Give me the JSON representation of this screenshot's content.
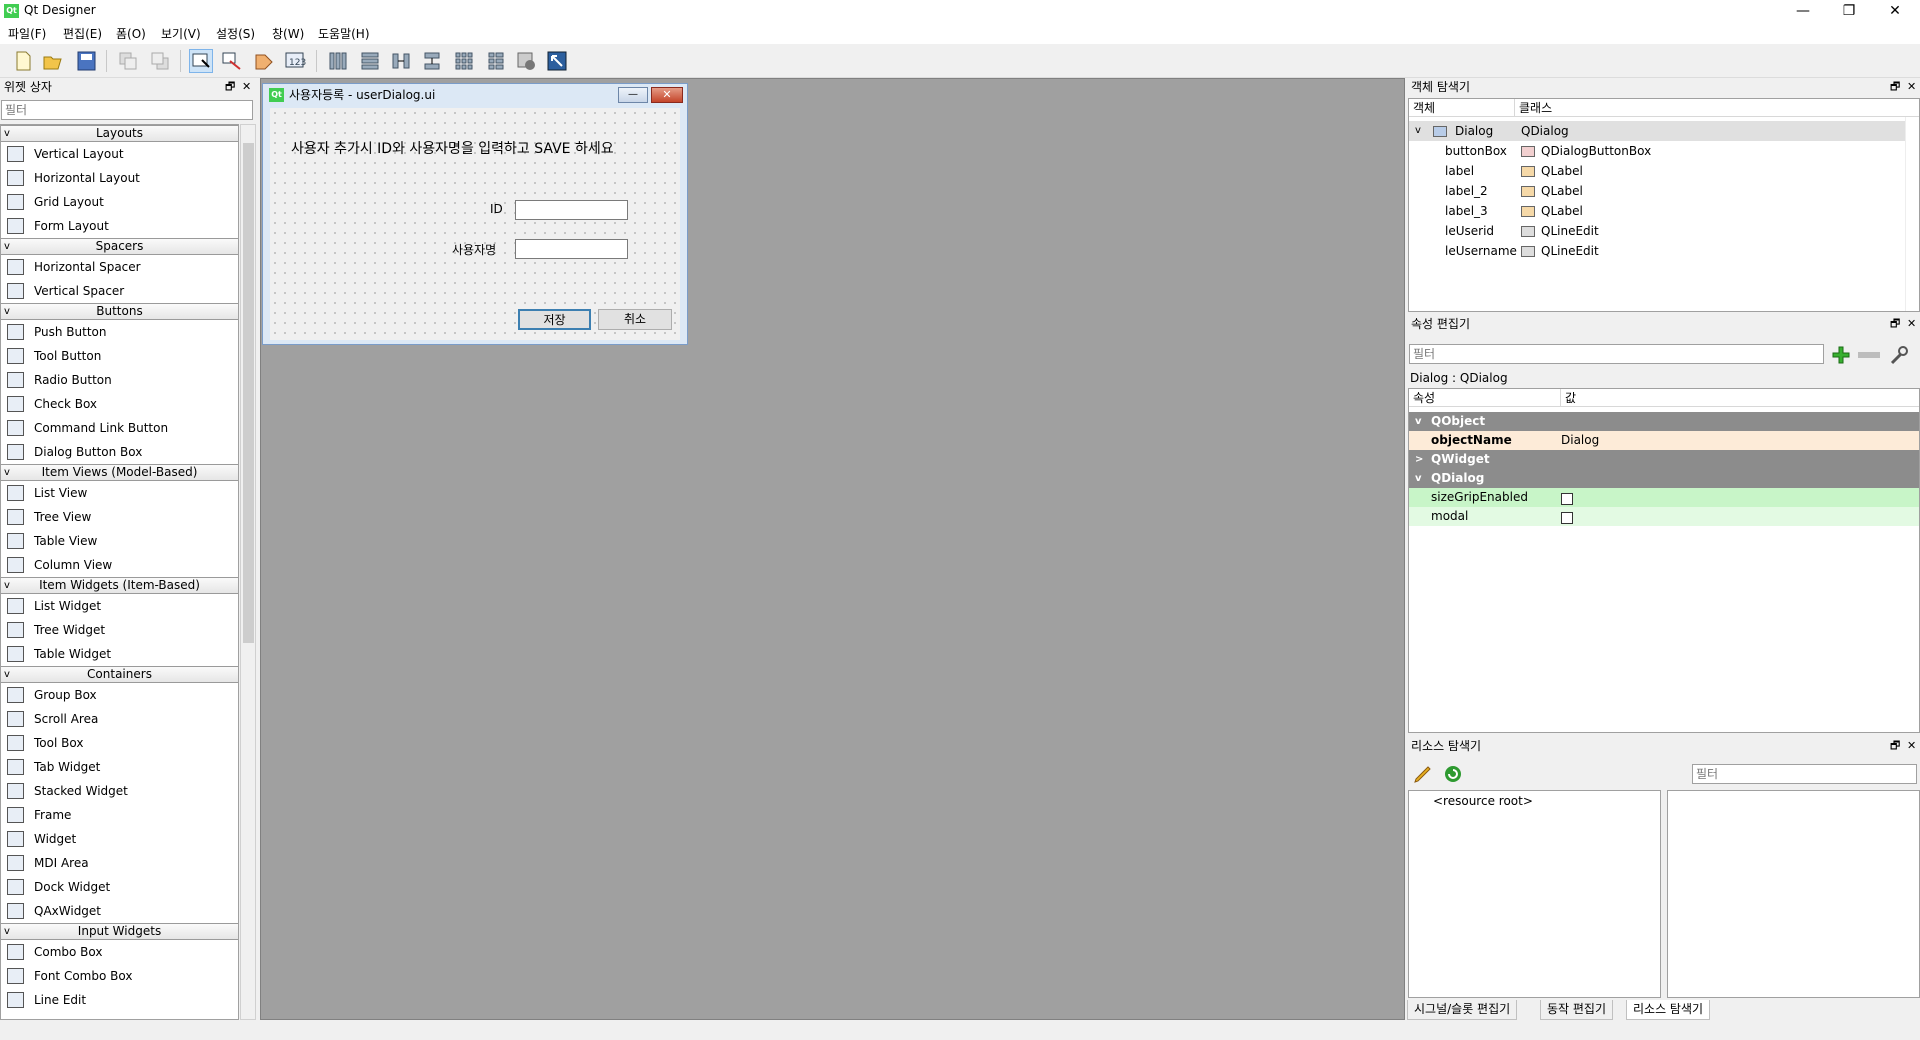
{
  "app": {
    "title": "Qt Designer",
    "logo": "Qt"
  },
  "window_controls": {
    "minimize": "—",
    "restore": "❐",
    "close": "✕"
  },
  "menu": [
    "파일(F)",
    "편집(E)",
    "폼(O)",
    "보기(V)",
    "설정(S)",
    "창(W)",
    "도움말(H)"
  ],
  "toolbar_icons": [
    "new-file-icon",
    "open-folder-icon",
    "save-icon",
    "send-to-back-icon",
    "bring-to-front-icon",
    "edit-widgets-icon",
    "edit-signals-slots-icon",
    "edit-buddies-icon",
    "edit-tab-order-icon",
    "layout-horizontal-icon",
    "layout-vertical-icon",
    "layout-h-splitter-icon",
    "layout-v-splitter-icon",
    "layout-grid-icon",
    "layout-form-icon",
    "break-layout-icon",
    "adjust-size-icon"
  ],
  "widget_box": {
    "title": "위젯 상자",
    "filter_placeholder": "필터",
    "categories": [
      {
        "name": "Layouts",
        "items": [
          "Vertical Layout",
          "Horizontal Layout",
          "Grid Layout",
          "Form Layout"
        ]
      },
      {
        "name": "Spacers",
        "items": [
          "Horizontal Spacer",
          "Vertical Spacer"
        ]
      },
      {
        "name": "Buttons",
        "items": [
          "Push Button",
          "Tool Button",
          "Radio Button",
          "Check Box",
          "Command Link Button",
          "Dialog Button Box"
        ]
      },
      {
        "name": "Item Views (Model-Based)",
        "items": [
          "List View",
          "Tree View",
          "Table View",
          "Column View"
        ]
      },
      {
        "name": "Item Widgets (Item-Based)",
        "items": [
          "List Widget",
          "Tree Widget",
          "Table Widget"
        ]
      },
      {
        "name": "Containers",
        "items": [
          "Group Box",
          "Scroll Area",
          "Tool Box",
          "Tab Widget",
          "Stacked Widget",
          "Frame",
          "Widget",
          "MDI Area",
          "Dock Widget",
          "QAxWidget"
        ]
      },
      {
        "name": "Input Widgets",
        "items": [
          "Combo Box",
          "Font Combo Box",
          "Line Edit"
        ]
      }
    ]
  },
  "form": {
    "title": "사용자등록 - userDialog.ui",
    "min": "—",
    "close": "✕",
    "heading": "사용자 추가시 ID와 사용자명을 입력하고 SAVE 하세요",
    "id_label": "ID",
    "username_label": "사용자명",
    "save_button": "저장",
    "cancel_button": "취소"
  },
  "object_inspector": {
    "title": "객체 탐색기",
    "col_object": "객체",
    "col_class": "클래스",
    "root": {
      "name": "Dialog",
      "class": "QDialog"
    },
    "children": [
      {
        "name": "buttonBox",
        "class": "QDialogButtonBox"
      },
      {
        "name": "label",
        "class": "QLabel"
      },
      {
        "name": "label_2",
        "class": "QLabel"
      },
      {
        "name": "label_3",
        "class": "QLabel"
      },
      {
        "name": "leUserid",
        "class": "QLineEdit"
      },
      {
        "name": "leUsername",
        "class": "QLineEdit"
      }
    ]
  },
  "property_editor": {
    "title": "속성 편집기",
    "filter_placeholder": "필터",
    "context": "Dialog : QDialog",
    "col_property": "속성",
    "col_value": "값",
    "groups": {
      "qobject": "QObject",
      "qwidget": "QWidget",
      "qdialog": "QDialog"
    },
    "object_name": {
      "name": "objectName",
      "value": "Dialog"
    },
    "size_grip": {
      "name": "sizeGripEnabled",
      "checked": false
    },
    "modal": {
      "name": "modal",
      "checked": false
    }
  },
  "resource_browser": {
    "title": "리소스 탐색기",
    "filter_placeholder": "필터",
    "root": "<resource root>"
  },
  "bottom_tabs": [
    "시그널/슬롯 편집기",
    "동작 편집기",
    "리소스 탐색기"
  ],
  "dock_controls": {
    "float": "🗗",
    "close": "✕"
  },
  "colors": {
    "qt_green": "#41cd52",
    "group_bg": "#8c8c8c",
    "object_name_bg": "#fdebd8",
    "dialog_prop_bg": "#c8f5c8",
    "selected_row": "#e0e0e0"
  }
}
